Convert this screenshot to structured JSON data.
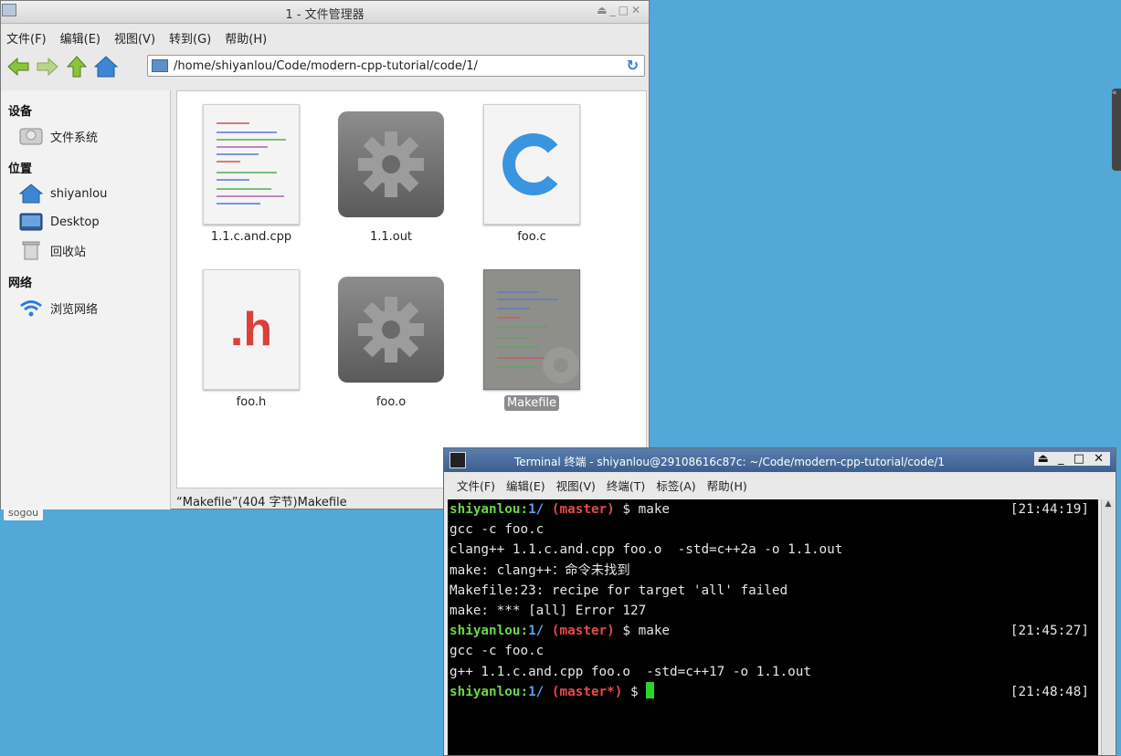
{
  "file_manager": {
    "title": "1 - 文件管理器",
    "menu": [
      "文件(F)",
      "编辑(E)",
      "视图(V)",
      "转到(G)",
      "帮助(H)"
    ],
    "address": "/home/shiyanlou/Code/modern-cpp-tutorial/code/1/",
    "sidebar": {
      "devices_header": "设备",
      "devices": [
        {
          "label": "文件系统",
          "icon": "drive-icon"
        }
      ],
      "places_header": "位置",
      "places": [
        {
          "label": "shiyanlou",
          "icon": "home-icon"
        },
        {
          "label": "Desktop",
          "icon": "desktop-icon"
        },
        {
          "label": "回收站",
          "icon": "trash-icon"
        }
      ],
      "network_header": "网络",
      "network": [
        {
          "label": "浏览网络",
          "icon": "wifi-icon"
        }
      ]
    },
    "files": [
      {
        "name": "1.1.c.and.cpp",
        "icon": "text-file-icon"
      },
      {
        "name": "1.1.out",
        "icon": "executable-icon"
      },
      {
        "name": "foo.c",
        "icon": "c-source-icon"
      },
      {
        "name": "foo.h",
        "icon": "header-file-icon"
      },
      {
        "name": "foo.o",
        "icon": "object-file-icon"
      },
      {
        "name": "Makefile",
        "icon": "makefile-icon",
        "selected": true
      }
    ],
    "status": "“Makefile”(404 字节)Makefile"
  },
  "desktop": {
    "sogou": "sogou"
  },
  "terminal": {
    "title": "Terminal 终端 - shiyanlou@29108616c87c: ~/Code/modern-cpp-tutorial/code/1",
    "menu": [
      "文件(F)",
      "编辑(E)",
      "视图(V)",
      "终端(T)",
      "标签(A)",
      "帮助(H)"
    ],
    "user": "shiyanlou:",
    "dir": "1/",
    "cmd1": "$ make",
    "branch1": "(master)",
    "time1": "[21:44:19]",
    "out1": [
      "gcc -c foo.c",
      "clang++ 1.1.c.and.cpp foo.o  -std=c++2a -o 1.1.out",
      "make: clang++：命令未找到",
      "Makefile:23: recipe for target 'all' failed",
      "make: *** [all] Error 127"
    ],
    "branch2": "(master)",
    "cmd2": "$ make",
    "time2": "[21:45:27]",
    "out2": [
      "gcc -c foo.c",
      "g++ 1.1.c.and.cpp foo.o  -std=c++17 -o 1.1.out"
    ],
    "branch3": "(master*)",
    "cmd3": "$",
    "time3": "[21:48:48]"
  },
  "colors": {
    "desktop": "#52a8d6",
    "prompt_user": "#6ad84a",
    "prompt_branch": "#e24b4b",
    "cursor": "#2ed22e"
  }
}
